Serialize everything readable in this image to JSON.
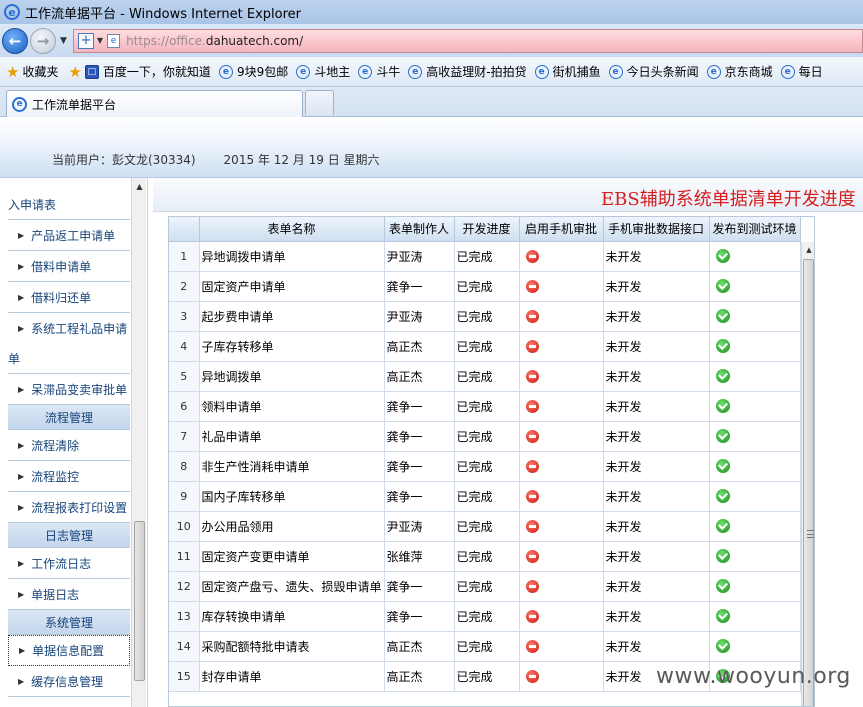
{
  "window": {
    "title": "工作流单据平台 - Windows Internet Explorer"
  },
  "address": {
    "url_dim": "https://office.",
    "url_main": "dahuatech.com/"
  },
  "favorites": {
    "label": "收藏夹",
    "items": [
      "百度一下，你就知道",
      "9块9包邮",
      "斗地主",
      "斗牛",
      "高收益理财-拍拍贷",
      "街机捕鱼",
      "今日头条新闻",
      "京东商城",
      "每日"
    ]
  },
  "tab": {
    "label": "工作流单据平台"
  },
  "header": {
    "user_label": "当前用户：彭文龙(30334)",
    "date": "2015 年 12 月 19 日 星期六"
  },
  "sidebar": {
    "top_partial": "入申请表",
    "items_a": [
      "产品返工申请单",
      "借料申请单",
      "借料归还单"
    ],
    "wrap_item": {
      "line1": "系统工程礼品申请",
      "line2": "单"
    },
    "items_b": [
      "呆滞品变卖审批单"
    ],
    "group_flow": "流程管理",
    "items_flow": [
      "流程清除",
      "流程监控",
      "流程报表打印设置"
    ],
    "group_log": "日志管理",
    "items_log": [
      "工作流日志",
      "单据日志"
    ],
    "group_sys": "系统管理",
    "items_sys": [
      "单据信息配置",
      "缓存信息管理"
    ]
  },
  "main": {
    "title": "EBS辅助系统单据清单开发进度",
    "columns": [
      "",
      "表单名称",
      "表单制作人",
      "开发进度",
      "启用手机审批",
      "手机审批数据接口",
      "发布到测试环境"
    ],
    "rows": [
      {
        "no": "1",
        "name": "异地调拨申请单",
        "author": "尹亚涛",
        "progress": "已完成",
        "mobile": "未开发"
      },
      {
        "no": "2",
        "name": "固定资产申请单",
        "author": "龚争一",
        "progress": "已完成",
        "mobile": "未开发"
      },
      {
        "no": "3",
        "name": "起步费申请单",
        "author": "尹亚涛",
        "progress": "已完成",
        "mobile": "未开发"
      },
      {
        "no": "4",
        "name": "子库存转移单",
        "author": "高正杰",
        "progress": "已完成",
        "mobile": "未开发"
      },
      {
        "no": "5",
        "name": "异地调拨单",
        "author": "高正杰",
        "progress": "已完成",
        "mobile": "未开发"
      },
      {
        "no": "6",
        "name": "领料申请单",
        "author": "龚争一",
        "progress": "已完成",
        "mobile": "未开发"
      },
      {
        "no": "7",
        "name": "礼品申请单",
        "author": "龚争一",
        "progress": "已完成",
        "mobile": "未开发"
      },
      {
        "no": "8",
        "name": "非生产性消耗申请单",
        "author": "龚争一",
        "progress": "已完成",
        "mobile": "未开发"
      },
      {
        "no": "9",
        "name": "国内子库转移单",
        "author": "龚争一",
        "progress": "已完成",
        "mobile": "未开发"
      },
      {
        "no": "10",
        "name": "办公用品领用",
        "author": "尹亚涛",
        "progress": "已完成",
        "mobile": "未开发"
      },
      {
        "no": "11",
        "name": "固定资产变更申请单",
        "author": "张维萍",
        "progress": "已完成",
        "mobile": "未开发"
      },
      {
        "no": "12",
        "name": "固定资产盘亏、遗失、损毁申请单",
        "author": "龚争一",
        "progress": "已完成",
        "mobile": "未开发"
      },
      {
        "no": "13",
        "name": "库存转换申请单",
        "author": "龚争一",
        "progress": "已完成",
        "mobile": "未开发"
      },
      {
        "no": "14",
        "name": "采购配额特批申请表",
        "author": "高正杰",
        "progress": "已完成",
        "mobile": "未开发"
      },
      {
        "no": "15",
        "name": "封存申请单",
        "author": "高正杰",
        "progress": "已完成",
        "mobile": "未开发"
      }
    ]
  },
  "watermark": "www.wooyun.org",
  "icons": {
    "red": "red-disabled-icon",
    "green": "green-check-icon"
  },
  "colors": {
    "title_red": "#d21f1f",
    "link_blue": "#17447a"
  }
}
